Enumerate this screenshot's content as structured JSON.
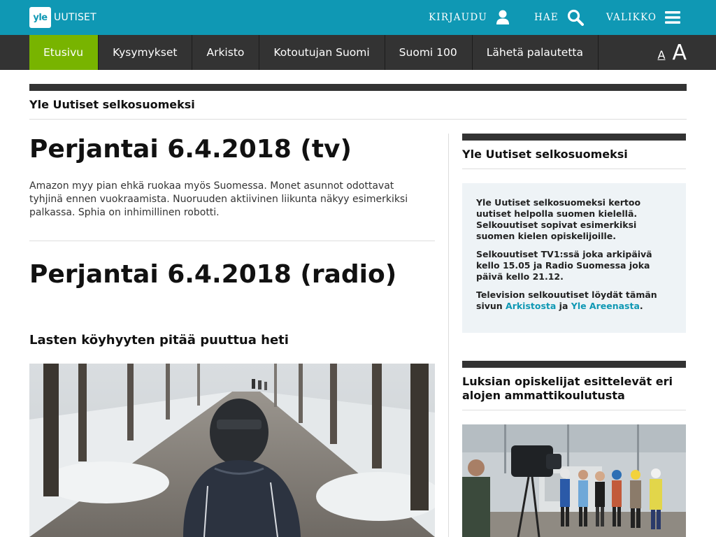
{
  "header": {
    "logo_mark": "yle",
    "logo_text": "UUTISET",
    "login_label": "KIRJAUDU",
    "search_label": "HAE",
    "menu_label": "VALIKKO",
    "color_primary": "#0f98b4"
  },
  "nav": {
    "items": [
      {
        "label": "Etusivu",
        "active": true
      },
      {
        "label": "Kysymykset"
      },
      {
        "label": "Arkisto"
      },
      {
        "label": "Kotoutujan Suomi"
      },
      {
        "label": "Suomi 100"
      },
      {
        "label": "Lähetä palautetta"
      }
    ],
    "font_small": "A",
    "font_large": "A",
    "color_active": "#78b400"
  },
  "section": {
    "title": "Yle Uutiset selkosuomeksi"
  },
  "main": {
    "tv_heading": "Perjantai 6.4.2018 (tv)",
    "tv_summary": "Amazon myy pian ehkä ruokaa myös Suomessa. Monet asunnot odottavat tyhjinä ennen vuokraamista. Nuoruuden aktiivinen liikunta näkyy esimerkiksi palkassa. Sphia on inhimillinen robotti.",
    "radio_heading": "Perjantai 6.4.2018 (radio)",
    "story_title": "Lasten köyhyyten pitää puuttua heti"
  },
  "sidebar": {
    "box_title": "Yle Uutiset selkosuomeksi",
    "para1": "Yle Uutiset selkosuomeksi kertoo uutiset helpolla suomen kielellä. Selkouutiset sopivat esimerkiksi suomen kielen opiskelijoille.",
    "para2": "Selkouutiset TV1:ssä joka arkipäivä kello 15.05 ja Radio Suomessa joka päivä kello 21.12.",
    "para3_pre": "Television selkouutiset löydät tämän sivun ",
    "link_archive": "Arkistosta",
    "para3_mid": " ja ",
    "link_areena": "Yle Areenasta",
    "para3_end": ".",
    "story_title": "Luksian opiskelijat esittelevät eri alojen ammattikoulutusta"
  }
}
